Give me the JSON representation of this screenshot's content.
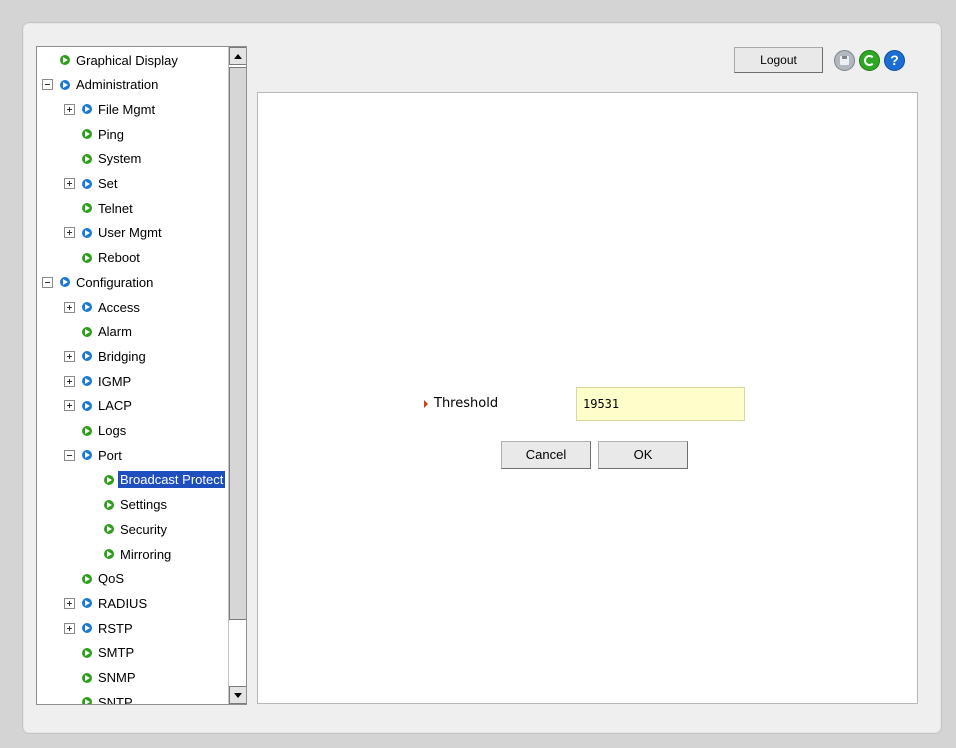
{
  "tree": {
    "items": [
      {
        "label": "Graphical Display",
        "icon": "leaf-node-icon",
        "expander": "none"
      },
      {
        "label": "Administration",
        "icon": "folder-node-icon",
        "expander": "minus"
      },
      {
        "label": "File Mgmt",
        "icon": "folder-node-icon",
        "expander": "plus"
      },
      {
        "label": "Ping",
        "icon": "leaf-node-icon",
        "expander": "none"
      },
      {
        "label": "System",
        "icon": "leaf-node-icon",
        "expander": "none"
      },
      {
        "label": "Set",
        "icon": "folder-node-icon",
        "expander": "plus"
      },
      {
        "label": "Telnet",
        "icon": "leaf-node-icon",
        "expander": "none"
      },
      {
        "label": "User Mgmt",
        "icon": "folder-node-icon",
        "expander": "plus"
      },
      {
        "label": "Reboot",
        "icon": "leaf-node-icon",
        "expander": "none"
      },
      {
        "label": "Configuration",
        "icon": "folder-node-icon",
        "expander": "minus"
      },
      {
        "label": "Access",
        "icon": "folder-node-icon",
        "expander": "plus"
      },
      {
        "label": "Alarm",
        "icon": "leaf-node-icon",
        "expander": "none"
      },
      {
        "label": "Bridging",
        "icon": "folder-node-icon",
        "expander": "plus"
      },
      {
        "label": "IGMP",
        "icon": "folder-node-icon",
        "expander": "plus"
      },
      {
        "label": "LACP",
        "icon": "folder-node-icon",
        "expander": "plus"
      },
      {
        "label": "Logs",
        "icon": "leaf-node-icon",
        "expander": "none"
      },
      {
        "label": "Port",
        "icon": "folder-node-icon",
        "expander": "minus"
      },
      {
        "label": "Broadcast Protect",
        "icon": "leaf-node-icon",
        "expander": "none",
        "selected": true
      },
      {
        "label": "Settings",
        "icon": "leaf-node-icon",
        "expander": "none"
      },
      {
        "label": "Security",
        "icon": "leaf-node-icon",
        "expander": "none"
      },
      {
        "label": "Mirroring",
        "icon": "leaf-node-icon",
        "expander": "none"
      },
      {
        "label": "QoS",
        "icon": "leaf-node-icon",
        "expander": "none"
      },
      {
        "label": "RADIUS",
        "icon": "folder-node-icon",
        "expander": "plus"
      },
      {
        "label": "RSTP",
        "icon": "folder-node-icon",
        "expander": "plus"
      },
      {
        "label": "SMTP",
        "icon": "leaf-node-icon",
        "expander": "none"
      },
      {
        "label": "SNMP",
        "icon": "leaf-node-icon",
        "expander": "none"
      },
      {
        "label": "SNTP",
        "icon": "leaf-node-icon",
        "expander": "none"
      }
    ]
  },
  "toolbar": {
    "logout_label": "Logout",
    "save_icon": "save-icon",
    "refresh_icon": "refresh-icon",
    "help_icon": "help-icon",
    "help_glyph": "?"
  },
  "form": {
    "threshold_label": "Threshold",
    "threshold_value": "19531",
    "cancel_label": "Cancel",
    "ok_label": "OK"
  },
  "colors": {
    "leaf_icon": "#2e9e1c",
    "folder_icon": "#1b78d4",
    "selection": "#1f4fbf",
    "input_background": "#ffffcc",
    "bullet": "#d04010"
  }
}
